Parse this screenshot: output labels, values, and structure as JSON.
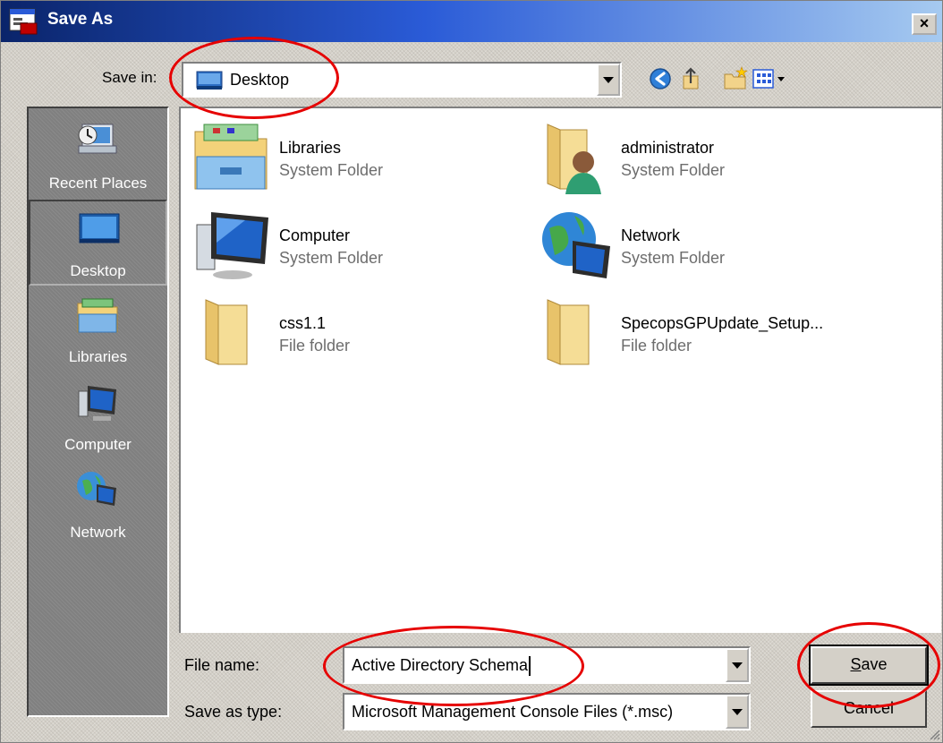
{
  "window": {
    "title": "Save As",
    "close_symbol": "×"
  },
  "save_in": {
    "label": "Save in:",
    "value": "Desktop",
    "icon": "desktop-icon"
  },
  "toolbar": {
    "icons": [
      "back-icon",
      "up-folder-icon",
      "new-folder-icon",
      "views-menu-icon"
    ]
  },
  "places": [
    {
      "label": "Recent Places",
      "icon": "recent-places-icon",
      "selected": false
    },
    {
      "label": "Desktop",
      "icon": "desktop-icon",
      "selected": true
    },
    {
      "label": "Libraries",
      "icon": "libraries-icon",
      "selected": false
    },
    {
      "label": "Computer",
      "icon": "computer-icon",
      "selected": false
    },
    {
      "label": "Network",
      "icon": "network-icon",
      "selected": false
    }
  ],
  "files": [
    {
      "name": "Libraries",
      "type": "System Folder",
      "icon": "libraries-folder-icon"
    },
    {
      "name": "administrator",
      "type": "System Folder",
      "icon": "user-folder-icon"
    },
    {
      "name": "Computer",
      "type": "System Folder",
      "icon": "computer-icon"
    },
    {
      "name": "Network",
      "type": "System Folder",
      "icon": "network-icon"
    },
    {
      "name": "css1.1",
      "type": "File folder",
      "icon": "folder-icon"
    },
    {
      "name": "SpecopsGPUpdate_Setup...",
      "type": "File folder",
      "icon": "folder-icon"
    }
  ],
  "file_name": {
    "label": "File name:",
    "value": "Active Directory Schema"
  },
  "save_as_type": {
    "label": "Save as type:",
    "value": "Microsoft Management Console Files (*.msc)"
  },
  "buttons": {
    "save_underlined": "S",
    "save_rest": "ave",
    "cancel": "Cancel"
  },
  "colors": {
    "annotation": "#e60000",
    "title_start": "#0a246a",
    "title_end": "#a6caf0"
  }
}
